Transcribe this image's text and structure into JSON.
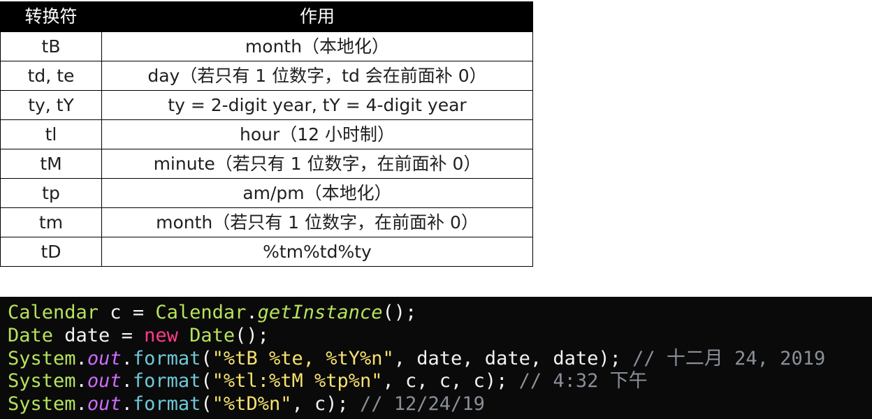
{
  "table": {
    "headers": [
      "转换符",
      "作用"
    ],
    "rows": [
      [
        "tB",
        "month（本地化）"
      ],
      [
        "td, te",
        "day（若只有 1 位数字，td 会在前面补 0）"
      ],
      [
        "ty, tY",
        "ty = 2-digit year, tY = 4-digit year"
      ],
      [
        "tl",
        "hour（12 小时制）"
      ],
      [
        "tM",
        "minute（若只有 1 位数字，在前面补 0）"
      ],
      [
        "tp",
        "am/pm（本地化）"
      ],
      [
        "tm",
        "month（若只有 1 位数字，在前面补 0）"
      ],
      [
        "tD",
        "%tm%td%ty"
      ]
    ]
  },
  "code": {
    "lines": [
      [
        {
          "cls": "t-cls",
          "text": "Calendar"
        },
        {
          "cls": "t-plain",
          "text": " c = "
        },
        {
          "cls": "t-cls",
          "text": "Calendar"
        },
        {
          "cls": "t-plain",
          "text": "."
        },
        {
          "cls": "t-method",
          "text": "getInstance"
        },
        {
          "cls": "t-plain",
          "text": "();"
        }
      ],
      [
        {
          "cls": "t-cls",
          "text": "Date"
        },
        {
          "cls": "t-plain",
          "text": " date = "
        },
        {
          "cls": "t-kw",
          "text": "new"
        },
        {
          "cls": "t-plain",
          "text": " "
        },
        {
          "cls": "t-cls",
          "text": "Date"
        },
        {
          "cls": "t-plain",
          "text": "();"
        }
      ],
      [
        {
          "cls": "t-cls",
          "text": "System"
        },
        {
          "cls": "t-plain",
          "text": "."
        },
        {
          "cls": "t-field",
          "text": "out"
        },
        {
          "cls": "t-plain",
          "text": "."
        },
        {
          "cls": "t-call",
          "text": "format"
        },
        {
          "cls": "t-plain",
          "text": "("
        },
        {
          "cls": "t-str",
          "text": "\"%tB %te, %tY%n\""
        },
        {
          "cls": "t-plain",
          "text": ", date, date, date); "
        },
        {
          "cls": "t-cmt",
          "text": "// 十二月 24, 2019"
        }
      ],
      [
        {
          "cls": "t-cls",
          "text": "System"
        },
        {
          "cls": "t-plain",
          "text": "."
        },
        {
          "cls": "t-field",
          "text": "out"
        },
        {
          "cls": "t-plain",
          "text": "."
        },
        {
          "cls": "t-call",
          "text": "format"
        },
        {
          "cls": "t-plain",
          "text": "("
        },
        {
          "cls": "t-str",
          "text": "\"%tl:%tM %tp%n\""
        },
        {
          "cls": "t-plain",
          "text": ", c, c, c); "
        },
        {
          "cls": "t-cmt",
          "text": "// 4:32 下午"
        }
      ],
      [
        {
          "cls": "t-cls",
          "text": "System"
        },
        {
          "cls": "t-plain",
          "text": "."
        },
        {
          "cls": "t-field",
          "text": "out"
        },
        {
          "cls": "t-plain",
          "text": "."
        },
        {
          "cls": "t-call",
          "text": "format"
        },
        {
          "cls": "t-plain",
          "text": "("
        },
        {
          "cls": "t-str",
          "text": "\"%tD%n\""
        },
        {
          "cls": "t-plain",
          "text": ", c); "
        },
        {
          "cls": "t-cmt",
          "text": "// 12/24/19"
        }
      ]
    ]
  }
}
